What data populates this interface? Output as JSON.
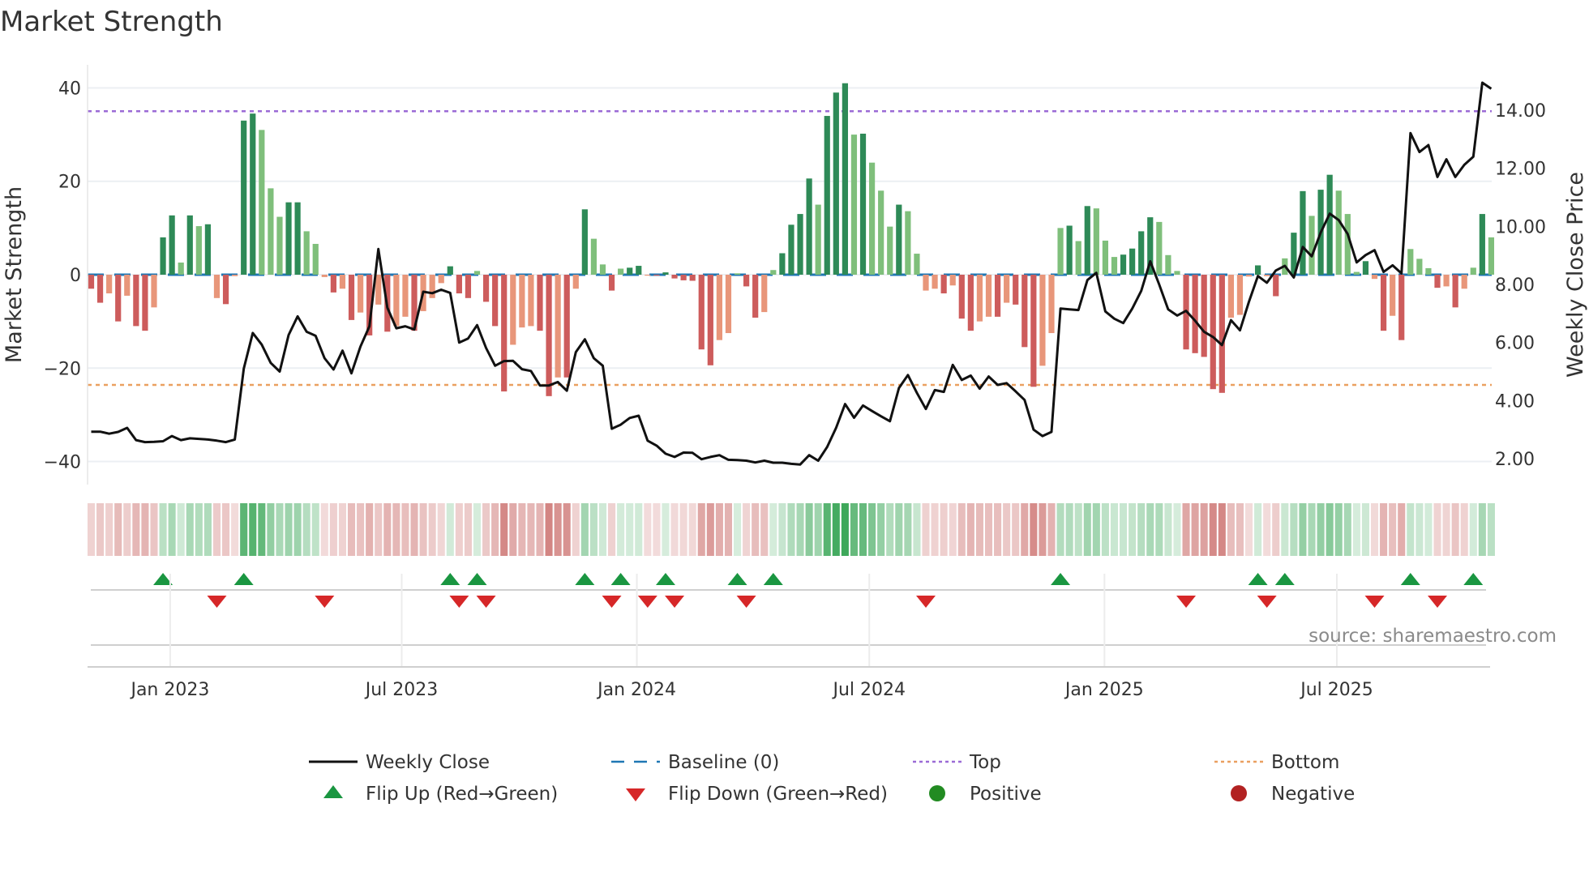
{
  "chart_data": {
    "type": "bar",
    "title": "Market Strength",
    "ylabel": "Market Strength",
    "y2label": "Weekly Close Price",
    "ylim": [
      -42,
      42
    ],
    "y2lim": [
      1.2,
      15.5
    ],
    "yticks": [
      40,
      20,
      0,
      -20,
      -40
    ],
    "yticklabels": [
      "40",
      "20",
      "0",
      "−20",
      "−40"
    ],
    "y2ticks": [
      2,
      4,
      6,
      8,
      10,
      12,
      14
    ],
    "y2ticklabels": [
      "2.00",
      "4.00",
      "6.00",
      "8.00",
      "10.00",
      "12.00",
      "14.00"
    ],
    "xticks": [
      {
        "label": "Jan 2023",
        "week": 8.8
      },
      {
        "label": "Jul 2023",
        "week": 34.6
      },
      {
        "label": "Jan 2024",
        "week": 60.8
      },
      {
        "label": "Jul 2024",
        "week": 86.7
      },
      {
        "label": "Jan 2025",
        "week": 112.9
      },
      {
        "label": "Jul 2025",
        "week": 138.8
      }
    ],
    "top_level": 35,
    "bottom_level": -23.6,
    "baseline": 0,
    "strength": [
      -3,
      -6,
      -4,
      -10,
      -4.5,
      -11,
      -12,
      -7,
      8,
      12.7,
      2.6,
      12.7,
      10.4,
      10.8,
      -5,
      -6.3,
      -0.3,
      33,
      34.5,
      31,
      18.5,
      12.4,
      15.5,
      15.5,
      9.3,
      6.6,
      -0.5,
      -3.8,
      -3,
      -9.7,
      -8.1,
      -13,
      -6.4,
      -12.2,
      -11,
      -9,
      -12,
      -7.8,
      -5,
      -1.8,
      1.8,
      -4,
      -5,
      0.8,
      -5.8,
      -11,
      -25,
      -15,
      -11.3,
      -11,
      -12,
      -26,
      -22,
      -22,
      -3,
      14,
      7.7,
      2.2,
      -3.4,
      1.3,
      1.5,
      1.9,
      -0.2,
      -0.2,
      0.5,
      -0.8,
      -1.2,
      -1.3,
      -16,
      -19.4,
      -14,
      -12.5,
      0.3,
      -2.5,
      -9.2,
      -8,
      1,
      4.6,
      10.7,
      13,
      20.6,
      15,
      34,
      39,
      41,
      30,
      30.2,
      24,
      18,
      10.3,
      15,
      13.6,
      4.5,
      -3.4,
      -3,
      -4,
      -2.3,
      -9.4,
      -12,
      -10,
      -9,
      -9,
      -6,
      -6.4,
      -15.5,
      -24,
      -19.5,
      -12.5,
      10,
      10.5,
      7.2,
      14.7,
      14.2,
      7.3,
      3.8,
      4.3,
      5.6,
      9.3,
      12.3,
      11.3,
      4.2,
      0.8,
      -16,
      -16.8,
      -17.6,
      -24.5,
      -25.3,
      -9.2,
      -8.6,
      -0.4,
      2,
      -0.3,
      -4.6,
      3.5,
      9,
      17.9,
      12.6,
      18.2,
      21.4,
      18,
      13,
      0.6,
      2.9,
      -0.9,
      -12,
      -8.8,
      -14,
      5.5,
      3.4,
      1.4,
      -2.8,
      -2.5,
      -7,
      -3,
      1.5,
      13,
      8
    ],
    "weekly_close": [
      2.93,
      2.93,
      2.86,
      2.92,
      3.06,
      2.64,
      2.57,
      2.58,
      2.6,
      2.78,
      2.64,
      2.7,
      2.68,
      2.66,
      2.62,
      2.57,
      2.66,
      5.1,
      6.33,
      5.93,
      5.3,
      5.0,
      6.26,
      6.9,
      6.37,
      6.23,
      5.46,
      5.07,
      5.72,
      4.94,
      5.86,
      6.56,
      9.22,
      7.2,
      6.49,
      6.56,
      6.45,
      7.75,
      7.7,
      7.82,
      7.71,
      6.0,
      6.14,
      6.6,
      5.81,
      5.2,
      5.36,
      5.37,
      5.08,
      5.02,
      4.52,
      4.52,
      4.64,
      4.34,
      5.67,
      6.11,
      5.46,
      5.2,
      3.03,
      3.17,
      3.4,
      3.48,
      2.62,
      2.45,
      2.17,
      2.06,
      2.21,
      2.2,
      1.98,
      2.06,
      2.12,
      1.96,
      1.95,
      1.93,
      1.87,
      1.93,
      1.86,
      1.86,
      1.82,
      1.8,
      2.12,
      1.93,
      2.4,
      3.06,
      3.88,
      3.41,
      3.83,
      3.64,
      3.46,
      3.29,
      4.43,
      4.88,
      4.27,
      3.71,
      4.36,
      4.3,
      5.23,
      4.71,
      4.86,
      4.41,
      4.83,
      4.54,
      4.6,
      4.32,
      4.02,
      3.0,
      2.78,
      2.92,
      7.17,
      7.14,
      7.12,
      8.15,
      8.4,
      7.07,
      6.82,
      6.67,
      7.17,
      7.78,
      8.8,
      8.0,
      7.14,
      6.93,
      7.09,
      6.75,
      6.37,
      6.19,
      5.91,
      6.77,
      6.42,
      7.4,
      8.29,
      8.06,
      8.48,
      8.64,
      8.24,
      9.29,
      8.97,
      9.79,
      10.44,
      10.22,
      9.74,
      8.76,
      9.01,
      9.18,
      8.43,
      8.66,
      8.38,
      13.21,
      12.56,
      12.8,
      11.7,
      12.31,
      11.7,
      12.12,
      12.4,
      14.95,
      14.74
    ],
    "flip_up_weeks": [
      8,
      17,
      40,
      43,
      55,
      59,
      64,
      72,
      76,
      108,
      130,
      133,
      147,
      154
    ],
    "flip_down_weeks": [
      14,
      26,
      41,
      44,
      58,
      62,
      65,
      73,
      93,
      122,
      131,
      143,
      150
    ],
    "legend": [
      {
        "label": "Weekly Close",
        "kind": "line"
      },
      {
        "label": "Baseline (0)",
        "kind": "dash"
      },
      {
        "label": "Top",
        "kind": "dot-purple"
      },
      {
        "label": "Bottom",
        "kind": "dot-orange"
      },
      {
        "label": "Flip Up (Red→Green)",
        "kind": "tri-up"
      },
      {
        "label": "Flip Down (Green→Red)",
        "kind": "tri-down"
      },
      {
        "label": "Positive",
        "kind": "dot-green"
      },
      {
        "label": "Negative",
        "kind": "dot-red"
      }
    ],
    "legend_placement": "bottom",
    "source": "source: sharemaestro.com"
  },
  "colors": {
    "pos_strong": "#2e8a57",
    "pos_weak": "#7fbf7b",
    "neg_strong": "#cd5c5c",
    "neg_weak": "#e8967a",
    "baseline": "#1f77b4",
    "top": "#9b6bd6",
    "bottom": "#eaa060",
    "line": "#111111",
    "flip_up": "#1a9641",
    "flip_down": "#d62728",
    "positive": "#228b22",
    "negative": "#b22222"
  }
}
